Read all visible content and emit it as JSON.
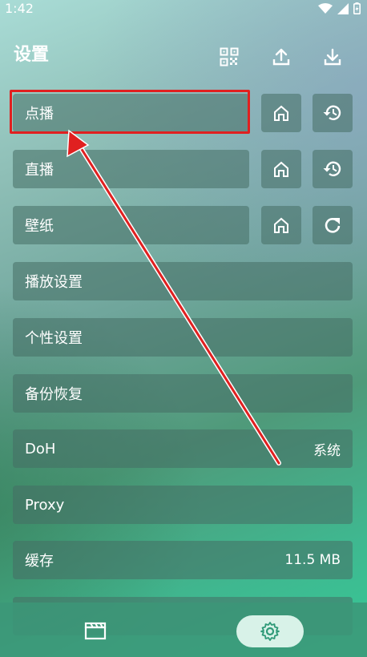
{
  "status": {
    "time": "1:42"
  },
  "header": {
    "title": "设置"
  },
  "rows": [
    {
      "label": "点播",
      "value": ""
    },
    {
      "label": "直播",
      "value": ""
    },
    {
      "label": "壁纸",
      "value": ""
    },
    {
      "label": "播放设置",
      "value": ""
    },
    {
      "label": "个性设置",
      "value": ""
    },
    {
      "label": "备份恢复",
      "value": ""
    },
    {
      "label": "DoH",
      "value": "系统"
    },
    {
      "label": "Proxy",
      "value": ""
    },
    {
      "label": "缓存",
      "value": "11.5 MB"
    }
  ],
  "icons": {
    "top": [
      "qr-code-icon",
      "upload-icon",
      "download-icon"
    ],
    "row_actions": [
      "home-icon",
      "history-icon",
      "refresh-icon"
    ],
    "nav": [
      "clapperboard-icon",
      "gear-icon"
    ]
  },
  "colors": {
    "highlight": "#e02020",
    "accent": "#3fbf8f",
    "nav_active": "#d8f2e8"
  }
}
